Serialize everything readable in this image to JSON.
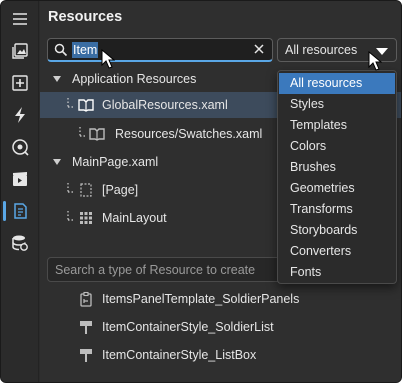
{
  "panel": {
    "title": "Resources"
  },
  "search": {
    "value": "Item"
  },
  "filter": {
    "selected": "All resources",
    "options": [
      "All resources",
      "Styles",
      "Templates",
      "Colors",
      "Brushes",
      "Geometries",
      "Transforms",
      "Storyboards",
      "Converters",
      "Fonts"
    ]
  },
  "tree": {
    "app_resources": "Application Resources",
    "global_resources": "GlobalResources.xaml",
    "swatches": "Resources/Swatches.xaml",
    "main_page": "MainPage.xaml",
    "page": "[Page]",
    "main_layout": "MainLayout"
  },
  "create": {
    "placeholder": "Search a type of Resource to create"
  },
  "resources": [
    "ItemsPanelTemplate_SoldierPanels",
    "ItemContainerStyle_SoldierList",
    "ItemContainerStyle_ListBox"
  ],
  "rail": [
    "menu-icon",
    "images-icon",
    "add-box-icon",
    "lightning-icon",
    "palette-icon",
    "media-icon",
    "resources-icon",
    "database-icon"
  ],
  "colors": {
    "accent": "#5aa7e6",
    "selection": "#3b79bd",
    "panel_bg": "#2f2f2f"
  }
}
